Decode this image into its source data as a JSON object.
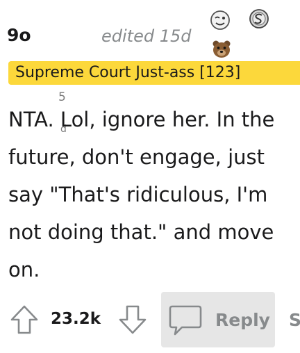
{
  "comment": {
    "username": "9o",
    "edited": "edited 15d",
    "flair": "Supreme Court Just-ass [123]",
    "award_count": "5",
    "award_unit": "d",
    "body": "NTA. Lol, ignore her. In the future, don't engage, just say \"That's ridiculous, I'm not doing that.\" and move on."
  },
  "awards": [
    "wink-face-icon",
    "silver-coin-icon",
    "bear-icon"
  ],
  "actions": {
    "vote_count": "23.2k",
    "reply_label": "Reply",
    "share_label": "S"
  },
  "colors": {
    "flair_bg": "#fcd83b",
    "meta_text": "#878a8c",
    "reply_bg": "#e6e6e6"
  }
}
